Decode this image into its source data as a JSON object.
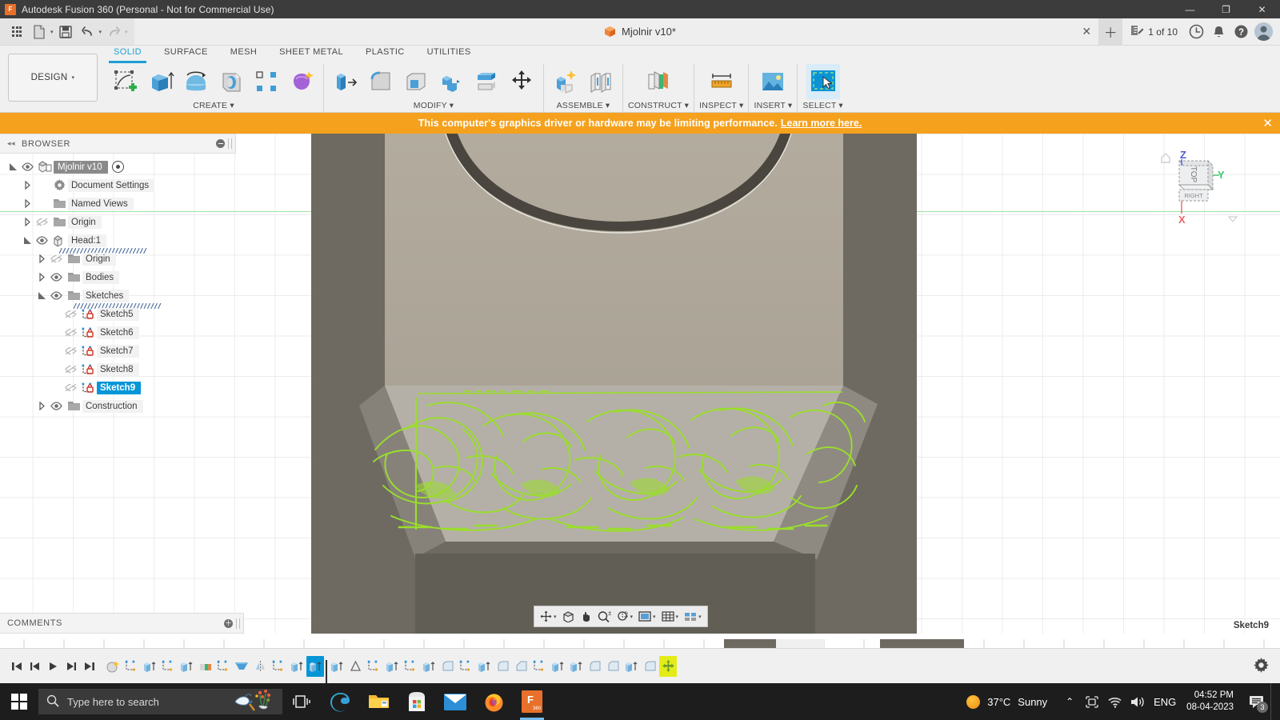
{
  "titlebar": {
    "app_title": "Autodesk Fusion 360 (Personal - Not for Commercial Use)",
    "logo_text": "F",
    "minimize": "—",
    "maximize": "❐",
    "close": "✕"
  },
  "qat": {
    "grid_icon": "app-grid-icon",
    "new_icon": "new-document-icon",
    "save_icon": "save-icon",
    "undo_icon": "undo-icon",
    "redo_icon": "redo-icon",
    "caret": "▾"
  },
  "doctab": {
    "title": "Mjolnir v10*",
    "close_label": "✕",
    "new_tab_label": "＋",
    "job_status": "1 of 10",
    "job_icon": "job-status-icon",
    "history_icon": "clock-icon",
    "notification_icon": "bell-icon",
    "help_icon": "help-icon",
    "account_icon": "account-avatar"
  },
  "ribbon": {
    "workspace": "DESIGN",
    "workspace_caret": "▾",
    "tabs": [
      {
        "label": "SOLID",
        "active": true
      },
      {
        "label": "SURFACE",
        "active": false
      },
      {
        "label": "MESH",
        "active": false
      },
      {
        "label": "SHEET METAL",
        "active": false
      },
      {
        "label": "PLASTIC",
        "active": false
      },
      {
        "label": "UTILITIES",
        "active": false
      }
    ],
    "panels": [
      {
        "label": "CREATE",
        "caret": "▾",
        "tools": [
          "create-sketch-icon",
          "extrude-icon",
          "revolve-icon",
          "sweep-icon",
          "pattern-icon",
          "form-icon"
        ]
      },
      {
        "label": "MODIFY",
        "caret": "▾",
        "tools": [
          "press-pull-icon",
          "fillet-icon",
          "shell-icon",
          "combine-icon",
          "offset-face-icon",
          "move-copy-icon"
        ]
      },
      {
        "label": "ASSEMBLE",
        "caret": "▾",
        "tools": [
          "new-component-icon",
          "joint-icon"
        ]
      },
      {
        "label": "CONSTRUCT",
        "caret": "▾",
        "tools": [
          "offset-plane-icon"
        ]
      },
      {
        "label": "INSPECT",
        "caret": "▾",
        "tools": [
          "measure-icon"
        ]
      },
      {
        "label": "INSERT",
        "caret": "▾",
        "tools": [
          "insert-mcmaster-icon"
        ]
      },
      {
        "label": "SELECT",
        "caret": "▾",
        "tools": [
          "select-window-icon"
        ]
      }
    ]
  },
  "banner": {
    "message": "This computer's graphics driver or hardware may be limiting performance.",
    "link": "Learn more here.",
    "close": "✕",
    "background": "#f5a11d"
  },
  "browser": {
    "title": "BROWSER",
    "collapse_icon": "◂◂",
    "tree": [
      {
        "label": "Mjolnir v10",
        "indent": 0,
        "arrow": "expanded",
        "eye": "visible",
        "icon": "component-icon",
        "root": true,
        "radio": true
      },
      {
        "label": "Document Settings",
        "indent": 1,
        "arrow": "collapsed",
        "eye": "none",
        "icon": "gear-icon"
      },
      {
        "label": "Named Views",
        "indent": 1,
        "arrow": "collapsed",
        "eye": "none",
        "icon": "folder-icon"
      },
      {
        "label": "Origin",
        "indent": 1,
        "arrow": "collapsed",
        "eye": "hidden",
        "icon": "folder-icon"
      },
      {
        "label": "Head:1",
        "indent": 1,
        "arrow": "expanded",
        "eye": "visible",
        "icon": "component-icon",
        "hatch": true
      },
      {
        "label": "Origin",
        "indent": 2,
        "arrow": "collapsed",
        "eye": "hidden",
        "icon": "folder-icon"
      },
      {
        "label": "Bodies",
        "indent": 2,
        "arrow": "collapsed",
        "eye": "visible",
        "icon": "folder-icon"
      },
      {
        "label": "Sketches",
        "indent": 2,
        "arrow": "expanded",
        "eye": "visible",
        "icon": "folder-icon",
        "hatch": true
      },
      {
        "label": "Sketch5",
        "indent": 3,
        "arrow": "none",
        "eye": "hidden",
        "icon": "sketch-icon"
      },
      {
        "label": "Sketch6",
        "indent": 3,
        "arrow": "none",
        "eye": "hidden",
        "icon": "sketch-icon"
      },
      {
        "label": "Sketch7",
        "indent": 3,
        "arrow": "none",
        "eye": "hidden",
        "icon": "sketch-icon"
      },
      {
        "label": "Sketch8",
        "indent": 3,
        "arrow": "none",
        "eye": "hidden",
        "icon": "sketch-icon"
      },
      {
        "label": "Sketch9",
        "indent": 3,
        "arrow": "none",
        "eye": "hidden",
        "icon": "sketch-icon",
        "selected": true
      },
      {
        "label": "Construction",
        "indent": 2,
        "arrow": "collapsed",
        "eye": "visible",
        "icon": "folder-icon"
      }
    ]
  },
  "comments": {
    "title": "COMMENTS",
    "add_icon": "＋"
  },
  "canvas": {
    "active_sketch_label": "Sketch9",
    "model_color": "#b7b1a4",
    "sketch_color": "#9ade2a",
    "background": "#6e6a61",
    "navbar_tools": [
      "orbit-icon",
      "look-at-icon",
      "pan-icon",
      "zoom-icon",
      "zoom-window-icon",
      "display-settings-icon",
      "grid-snap-icon",
      "viewport-layout-icon"
    ]
  },
  "viewcube": {
    "top_face": "TOP",
    "front_face": "RIGHT",
    "axis_z": "Z",
    "axis_y": "Y",
    "axis_x": "X",
    "home_icon": "home-icon"
  },
  "timeline": {
    "controls": [
      "go-to-beginning-icon",
      "step-back-icon",
      "play-icon",
      "step-forward-icon",
      "go-to-end-icon"
    ],
    "features": [
      "form-feature-icon",
      "sketch-feature-icon",
      "extrude-feature-icon",
      "sketch-feature-icon",
      "extrude-feature-icon",
      "revolve-feature-icon",
      "sketch-feature-icon",
      "loft-feature-icon",
      "mirror-feature-icon",
      "sketch-feature-icon",
      "extrude-feature-icon",
      "extrude-feature-selected-icon",
      "extrude-feature-icon",
      "draft-feature-icon",
      "sketch-feature-icon",
      "extrude-feature-icon",
      "sketch-feature-icon",
      "extrude-feature-icon",
      "fillet-feature-icon",
      "sketch-feature-icon",
      "extrude-feature-icon",
      "fillet-feature-icon",
      "chamfer-feature-icon",
      "sketch-feature-icon",
      "extrude-feature-icon",
      "extrude-feature-icon",
      "fillet-feature-icon",
      "fillet-feature-icon",
      "extrude-feature-icon",
      "fillet-feature-icon",
      "move-feature-highlighted-icon"
    ],
    "settings_icon": "gear-icon"
  },
  "taskbar": {
    "start_icon": "windows-start-icon",
    "search_placeholder": "Type here to search",
    "search_icon": "search-icon",
    "cortana_icon": "weather-doodle-icon",
    "taskview_icon": "task-view-icon",
    "apps": [
      "edge-icon",
      "file-explorer-icon",
      "microsoft-store-icon",
      "mail-icon",
      "firefox-icon",
      "fusion360-icon"
    ],
    "weather_temp": "37°C",
    "weather_desc": "Sunny",
    "tray_chevron": "⌃",
    "tray_icons": [
      "screen-capture-icon",
      "wifi-icon",
      "volume-icon"
    ],
    "language": "ENG",
    "time": "04:52 PM",
    "date": "08-04-2023",
    "notification_count": "3"
  }
}
